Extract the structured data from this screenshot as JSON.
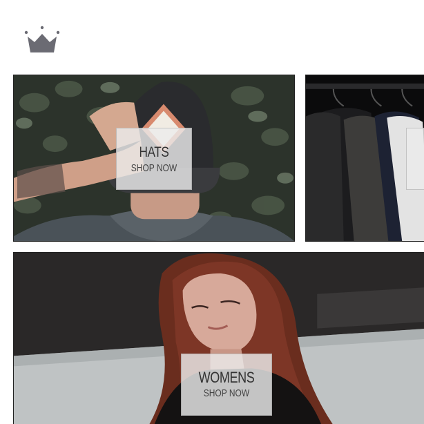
{
  "brand": {
    "logo_icon": "crown-icon",
    "logo_color": "#6b6b73"
  },
  "tiles": {
    "hats": {
      "title": "HATS",
      "cta": "SHOP NOW"
    },
    "mens": {
      "title": "",
      "cta": ""
    },
    "womens": {
      "title": "WOMENS",
      "cta": "SHOP NOW"
    }
  },
  "colors": {
    "label_bg": "#ebebeb",
    "label_text": "#333333",
    "border": "#222222"
  }
}
